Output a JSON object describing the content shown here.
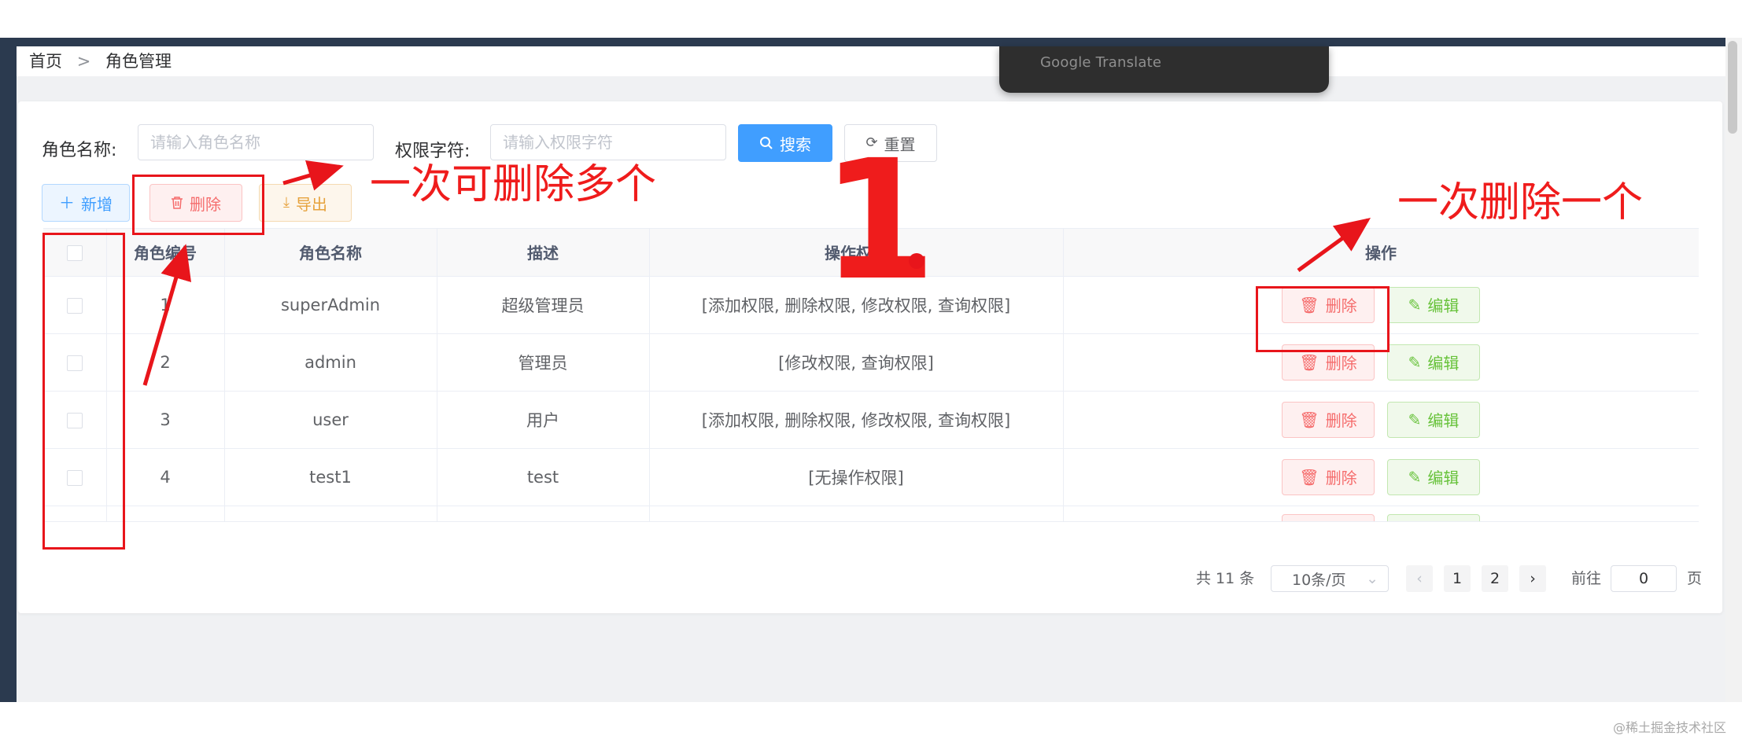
{
  "breadcrumb": {
    "home": "首页",
    "separator": ">",
    "current": "角色管理"
  },
  "overlay": {
    "google_translate": "Google Translate"
  },
  "search": {
    "role_name_label": "角色名称:",
    "role_name_placeholder": "请输入角色名称",
    "perm_label": "权限字符:",
    "perm_placeholder": "请输入权限字符",
    "search_button": "搜索",
    "reset_button": "重置"
  },
  "toolbar": {
    "add_button": "新增",
    "delete_button": "删除",
    "export_button": "导出"
  },
  "table": {
    "headers": {
      "id": "角色编号",
      "name": "角色名称",
      "desc": "描述",
      "perms": "操作权限",
      "ops": "操作"
    },
    "rows": [
      {
        "id": "1",
        "name": "superAdmin",
        "desc": "超级管理员",
        "perms": "[添加权限, 删除权限, 修改权限, 查询权限]",
        "delete": "删除",
        "edit": "编辑"
      },
      {
        "id": "2",
        "name": "admin",
        "desc": "管理员",
        "perms": "[修改权限, 查询权限]",
        "delete": "删除",
        "edit": "编辑"
      },
      {
        "id": "3",
        "name": "user",
        "desc": "用户",
        "perms": "[添加权限, 删除权限, 修改权限, 查询权限]",
        "delete": "删除",
        "edit": "编辑"
      },
      {
        "id": "4",
        "name": "test1",
        "desc": "test",
        "perms": "[无操作权限]",
        "delete": "删除",
        "edit": "编辑"
      }
    ]
  },
  "pagination": {
    "total": "共 11 条",
    "page_size": "10条/页",
    "pages": [
      "1",
      "2"
    ],
    "prev": "‹",
    "next": "›",
    "goto_label": "前往",
    "goto_value": "0",
    "page_suffix": "页"
  },
  "annotations": {
    "multi_delete": "一次可删除多个",
    "single_delete": "一次删除一个",
    "number": "1"
  },
  "watermark": "@稀土掘金技术社区",
  "colors": {
    "primary": "#409eff",
    "danger": "#f56c6c",
    "success": "#67c23a",
    "warning": "#e6a23c",
    "annotation_red": "#e8151b",
    "sidebar_dark": "#2b3a4f"
  }
}
